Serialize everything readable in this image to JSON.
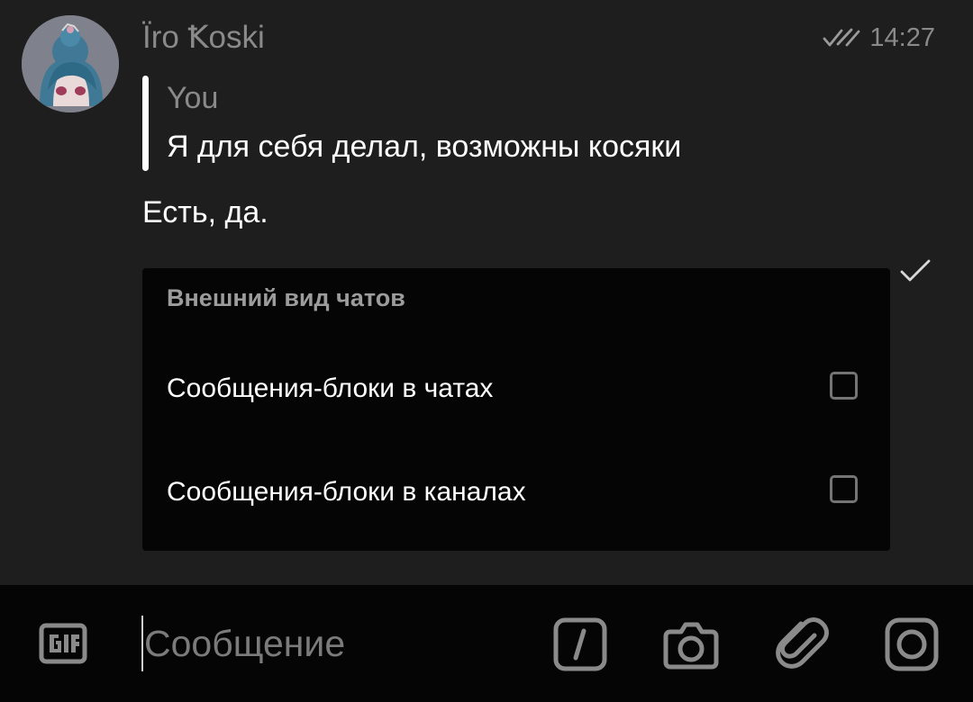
{
  "message": {
    "sender": "Ïro Ꝁoski",
    "time": "14:27",
    "delivery_status_icon": "double-check-icon",
    "reply": {
      "author": "You",
      "text": "Я для себя делал, возможны косяки"
    },
    "text": "Есть, да."
  },
  "settings_card": {
    "title": "Внешний вид чатов",
    "rows": [
      {
        "label": "Сообщения-блоки в чатах",
        "checked": false
      },
      {
        "label": "Сообщения-блоки в каналах",
        "checked": false
      }
    ],
    "status_icon": "check-icon"
  },
  "composer": {
    "placeholder": "Сообщение",
    "value": "",
    "icons": [
      "gif-icon",
      "slash-command-icon",
      "camera-icon",
      "paperclip-icon",
      "instant-camera-icon"
    ]
  },
  "colors": {
    "background": "#1e1e1e",
    "card_background": "#050505",
    "input_bar": "#050505",
    "primary_text": "#ffffff",
    "secondary_text": "#8a8a8a",
    "checkbox_border": "#747474"
  }
}
